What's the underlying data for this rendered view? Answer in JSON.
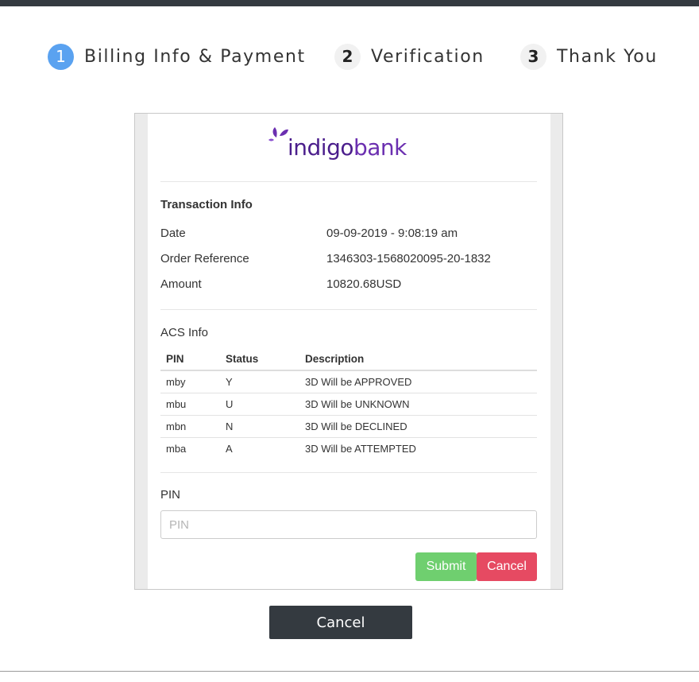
{
  "steps": [
    {
      "number": "1",
      "label": "Billing Info & Payment",
      "active": true
    },
    {
      "number": "2",
      "label": "Verification",
      "active": false
    },
    {
      "number": "3",
      "label": "Thank You",
      "active": false
    }
  ],
  "bank": {
    "logo_part1": "indigo",
    "logo_part2": "bank",
    "colors": {
      "primary": "#4b1e8c",
      "secondary": "#6b2fb0"
    }
  },
  "transaction": {
    "title": "Transaction Info",
    "rows": [
      {
        "label": "Date",
        "value": "09-09-2019 - 9:08:19 am"
      },
      {
        "label": "Order Reference",
        "value": "1346303-1568020095-20-1832"
      },
      {
        "label": "Amount",
        "value": "10820.68USD"
      }
    ]
  },
  "acs": {
    "title": "ACS Info",
    "headers": [
      "PIN",
      "Status",
      "Description"
    ],
    "rows": [
      [
        "mby",
        "Y",
        "3D Will be APPROVED"
      ],
      [
        "mbu",
        "U",
        "3D Will be UNKNOWN"
      ],
      [
        "mbn",
        "N",
        "3D Will be DECLINED"
      ],
      [
        "mba",
        "A",
        "3D Will be ATTEMPTED"
      ]
    ]
  },
  "pin": {
    "label": "PIN",
    "placeholder": "PIN",
    "value": ""
  },
  "buttons": {
    "submit": "Submit",
    "cancel": "Cancel",
    "outer_cancel": "Cancel"
  },
  "colors": {
    "step_active": "#5aa2f0",
    "submit": "#6fcf6f",
    "cancel": "#e64a62",
    "dark": "#343a40"
  }
}
